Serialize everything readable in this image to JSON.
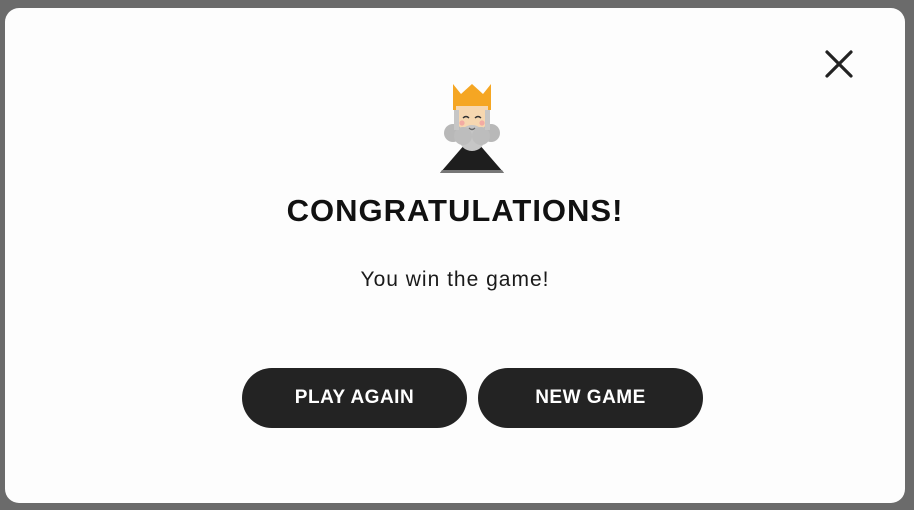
{
  "dialog": {
    "title": "CONGRATULATIONS!",
    "message": "You win the game!",
    "close_icon": "close-icon",
    "illustration": "king-icon"
  },
  "buttons": {
    "play_again": "PLAY AGAIN",
    "new_game": "NEW GAME"
  },
  "colors": {
    "overlay": "#6b6b6b",
    "dialog_bg": "#fdfdfd",
    "button_bg": "#232323",
    "button_text": "#ffffff",
    "crown": "#f5a623"
  }
}
